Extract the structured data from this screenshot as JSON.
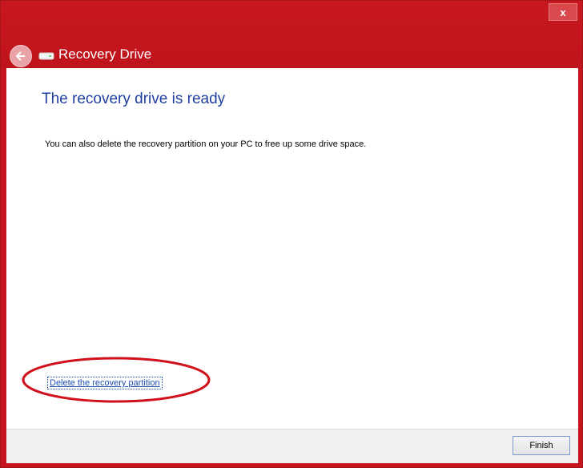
{
  "window": {
    "title": "Recovery Drive",
    "close_label": "x"
  },
  "content": {
    "heading": "The recovery drive is ready",
    "message": "You can also delete the recovery partition on your PC to free up some drive space.",
    "delete_link": "Delete the recovery partition"
  },
  "footer": {
    "finish_label": "Finish"
  },
  "icons": {
    "back": "back-arrow-icon",
    "drive": "drive-icon",
    "close": "close-icon"
  },
  "colors": {
    "title_bar": "#c4161e",
    "heading": "#1f3fa0",
    "link": "#1f4fb4",
    "highlight": "#d0101a"
  }
}
